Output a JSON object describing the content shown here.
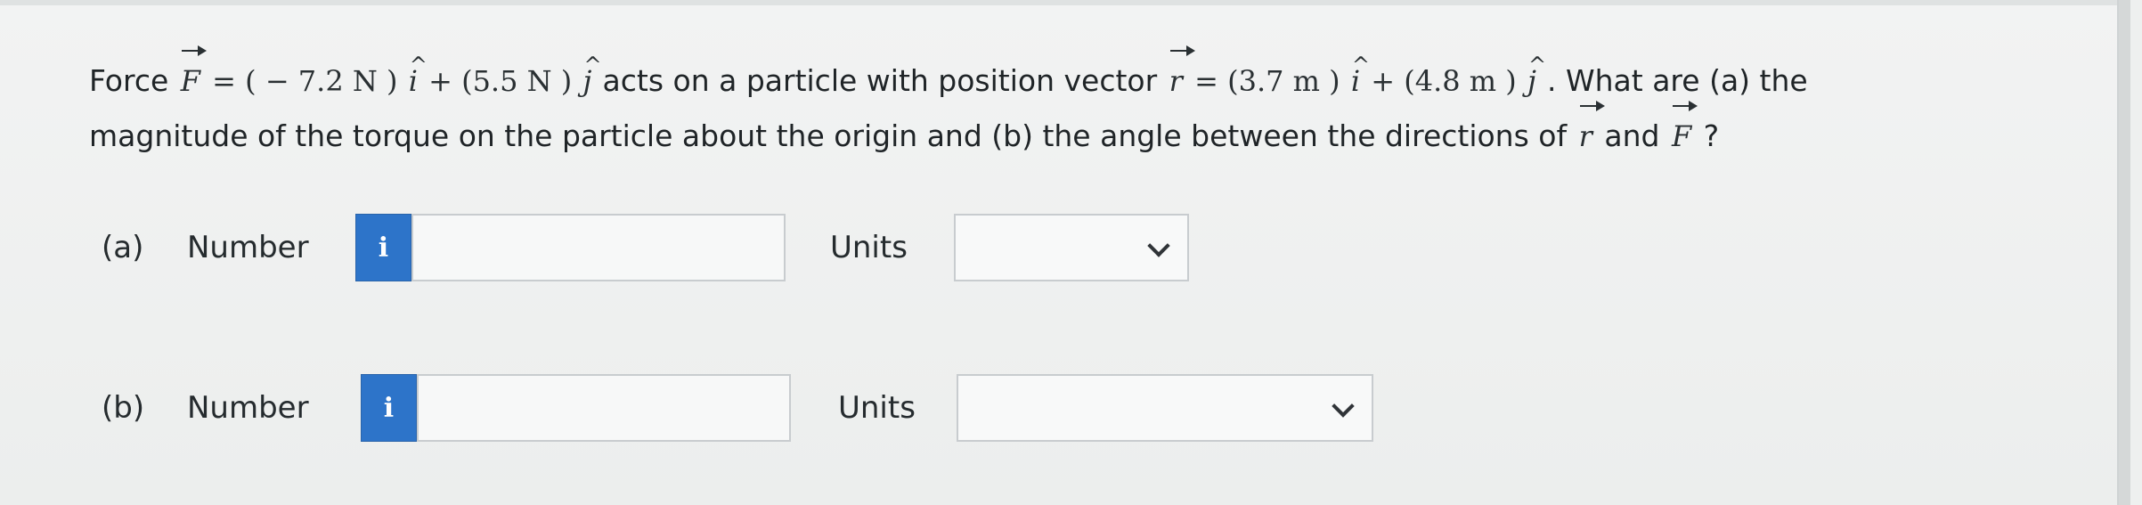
{
  "question": {
    "line1": {
      "prefix": "Force",
      "force_symbol": "F",
      "eq1": "= ( − 7.2 N )",
      "i1": "i",
      "plus1": "+ (5.5 N )",
      "j1": "j",
      "middle": " acts on a particle with position vector ",
      "position_symbol": "r",
      "eq2": "= (3.7 m )",
      "i2": "i",
      "plus2": "+ (4.8 m )",
      "j2": "j",
      "suffix": ". What are (a) the"
    },
    "line2": {
      "text": "magnitude of the torque on the particle about the origin and (b) the angle between the directions of ",
      "position_symbol": "r",
      "and_text": " and ",
      "force_symbol": "F",
      "suffix": "?"
    }
  },
  "parts": [
    {
      "label": "(a)",
      "number_label": "Number",
      "info_icon": "i",
      "input_value": "",
      "units_label": "Units",
      "selected_unit": ""
    },
    {
      "label": "(b)",
      "number_label": "Number",
      "info_icon": "i",
      "input_value": "",
      "units_label": "Units",
      "selected_unit": ""
    }
  ],
  "colors": {
    "background": "#eef0ef",
    "info_button": "#2d74c9",
    "border": "#c8cccf",
    "text": "#1f2427"
  }
}
